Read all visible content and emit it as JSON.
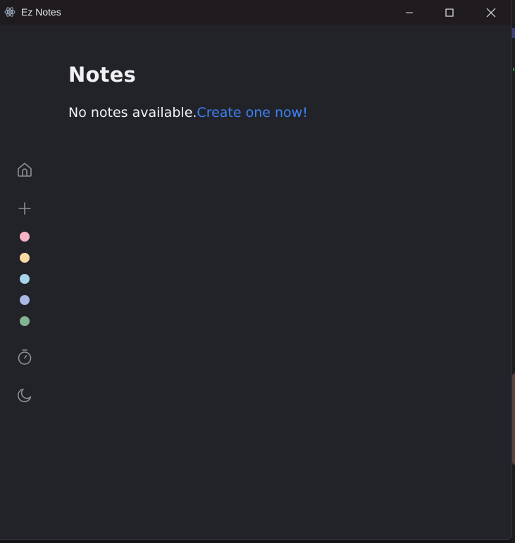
{
  "window": {
    "title": "Ez Notes",
    "app_icon": "electron-atom-icon",
    "controls": [
      "minimize-icon",
      "maximize-icon",
      "close-icon"
    ]
  },
  "sidebar": {
    "items": [
      {
        "icon": "home-icon"
      },
      {
        "icon": "plus-icon"
      }
    ],
    "colors": [
      "#f7b4c4",
      "#fcd8a2",
      "#a8d4ea",
      "#aab8e8",
      "#82b393"
    ],
    "bottom_items": [
      {
        "icon": "timer-icon"
      },
      {
        "icon": "moon-icon"
      }
    ]
  },
  "main": {
    "heading": "Notes",
    "empty_text": "No notes available.",
    "create_link": "Create one now!"
  },
  "theme": {
    "background": "#222328",
    "titlebar": "#201b1f",
    "link": "#3b82f6",
    "icon": "#8e8f95"
  }
}
